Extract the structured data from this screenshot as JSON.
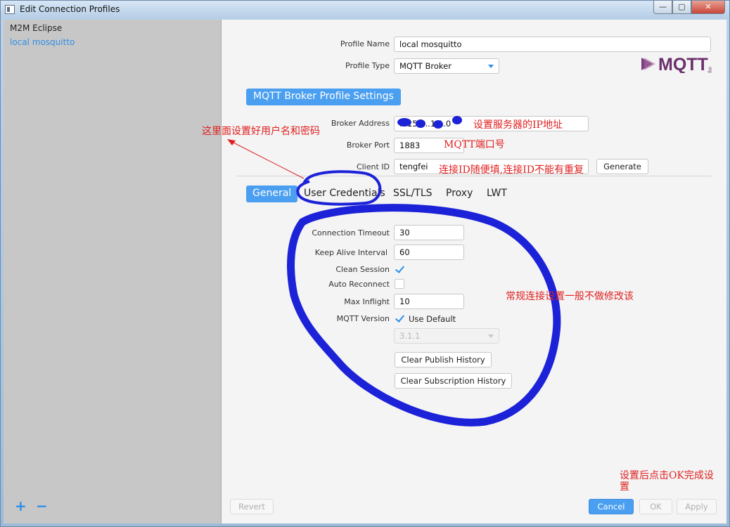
{
  "window": {
    "title": "Edit Connection Profiles",
    "minimize": "—",
    "maximize": "▢",
    "close": "✕"
  },
  "sidebar": {
    "items": [
      {
        "label": "M2M Eclipse"
      },
      {
        "label": "local mosquitto"
      }
    ],
    "add": "+",
    "remove": "−"
  },
  "profile": {
    "name_label": "Profile Name",
    "name_value": "local mosquitto",
    "type_label": "Profile Type",
    "type_value": "MQTT Broker",
    "logo_text": "MQTT",
    "logo_sub": "org"
  },
  "broker": {
    "section_title": "MQTT Broker Profile Settings",
    "address_label": "Broker Address",
    "address_value": "...159...1.1.0",
    "port_label": "Broker Port",
    "port_value": "1883",
    "client_id_label": "Client ID",
    "client_id_value": "tengfei",
    "generate_label": "Generate"
  },
  "tabs": [
    {
      "label": "General"
    },
    {
      "label": "User Credentials"
    },
    {
      "label": "SSL/TLS"
    },
    {
      "label": "Proxy"
    },
    {
      "label": "LWT"
    }
  ],
  "general": {
    "timeout_label": "Connection Timeout",
    "timeout_value": "30",
    "keepalive_label": "Keep Alive Interval",
    "keepalive_value": "60",
    "clean_session_label": "Clean Session",
    "auto_reconnect_label": "Auto Reconnect",
    "max_inflight_label": "Max Inflight",
    "max_inflight_value": "10",
    "mqtt_version_label": "MQTT Version",
    "use_default_label": "Use Default",
    "version_value": "3.1.1",
    "clear_publish_label": "Clear Publish History",
    "clear_subscription_label": "Clear Subscription History"
  },
  "footer": {
    "revert": "Revert",
    "cancel": "Cancel",
    "ok": "OK",
    "apply": "Apply"
  },
  "annotations": {
    "credentials_note": "这里面设置好用户名和密码",
    "ip_note": "设置服务器的IP地址",
    "port_note": "MQTT端口号",
    "client_id_note": "连接ID随便填,连接ID不能有重复",
    "general_note": "常规连接设置一般不做修改该",
    "ok_note_line1": "设置后点击OK完成设",
    "ok_note_line2": "置"
  },
  "colors": {
    "accent": "#4a9ff0",
    "annotation_red": "#e02020",
    "marker_blue": "#1c22d8"
  }
}
